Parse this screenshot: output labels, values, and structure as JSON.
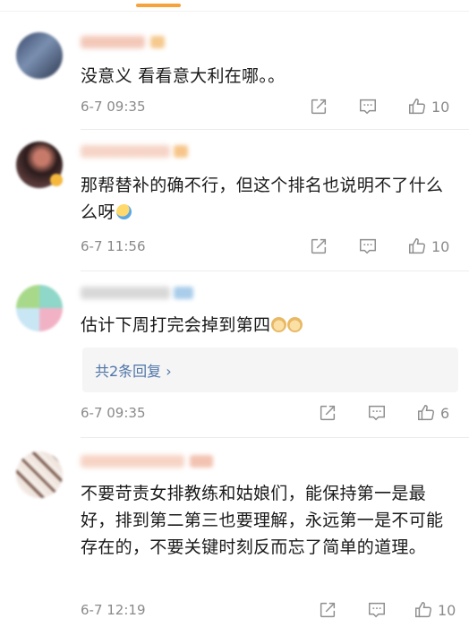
{
  "comments": [
    {
      "text": "没意义 看看意大利在哪。。",
      "time": "6-7 09:35",
      "likes": "10"
    },
    {
      "text": "那帮替补的确不行，但这个排名也说明不了什么么呀",
      "time": "6-7 11:56",
      "likes": "10"
    },
    {
      "text": "估计下周打完会掉到第四",
      "time": "6-7 09:35",
      "likes": "6",
      "replies_label": "共2条回复 ›"
    },
    {
      "text": "不要苛责女排教练和姑娘们，能保持第一是最好，排到第二第三也要理解，永远第一是不可能存在的，不要关键时刻反而忘了简单的道理。",
      "time": "6-7 12:19",
      "likes": "10"
    }
  ]
}
